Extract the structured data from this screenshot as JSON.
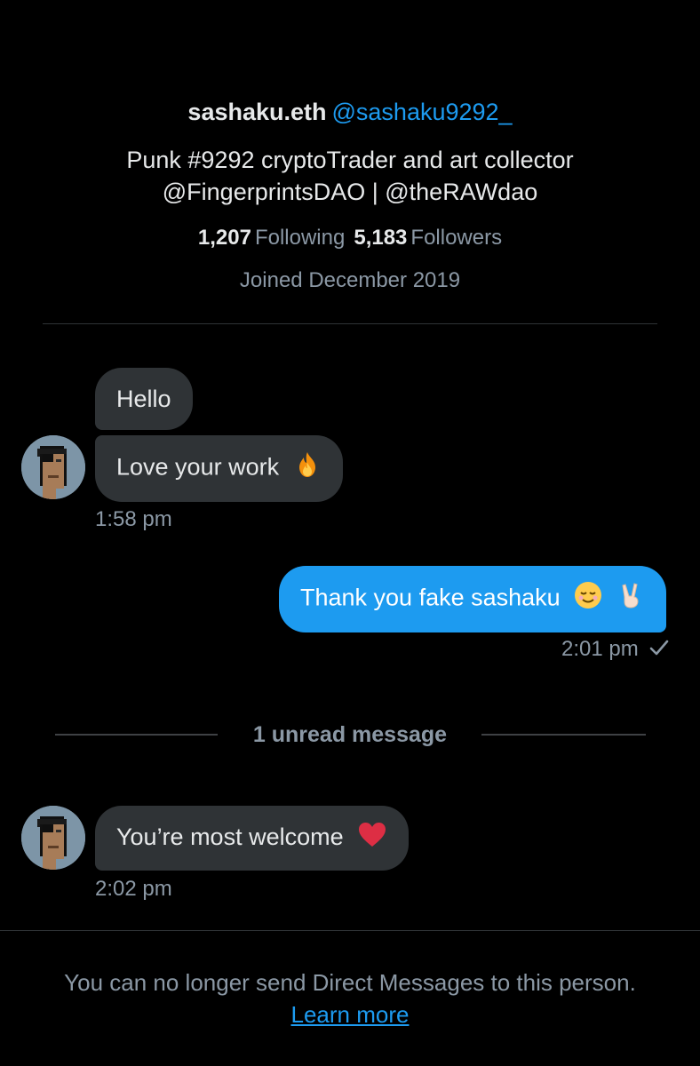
{
  "profile": {
    "display_name": "sashaku.eth",
    "handle": "@sashaku9292_",
    "bio_line1": "Punk #9292 cryptoTrader and art collector",
    "bio_line2": "@FingerprintsDAO | @theRAWdao",
    "following_count": "1,207",
    "following_label": "Following",
    "followers_count": "5,183",
    "followers_label": "Followers",
    "joined": "Joined December 2019"
  },
  "messages": [
    {
      "direction": "incoming",
      "text": "Hello"
    },
    {
      "direction": "incoming",
      "text": "Love your work",
      "emoji": "fire-emoji"
    },
    {
      "time": "1:58 pm"
    },
    {
      "direction": "outgoing",
      "text": "Thank you fake sashaku",
      "emoji": [
        "relieved-face-emoji",
        "victory-hand-emoji"
      ]
    },
    {
      "time": "2:01 pm",
      "status_icon": "check-icon"
    },
    {
      "direction": "incoming",
      "text": "You’re most welcome",
      "emoji": "red-heart-emoji"
    },
    {
      "time": "2:02 pm"
    }
  ],
  "unread_separator": "1 unread message",
  "footer": {
    "notice": "You can no longer send Direct Messages to this person.",
    "link": "Learn more"
  },
  "colors": {
    "background": "#000000",
    "incoming_bubble": "#2f3336",
    "outgoing_bubble": "#1d9bf0",
    "accent": "#1d9bf0",
    "muted_text": "#8b98a5"
  }
}
